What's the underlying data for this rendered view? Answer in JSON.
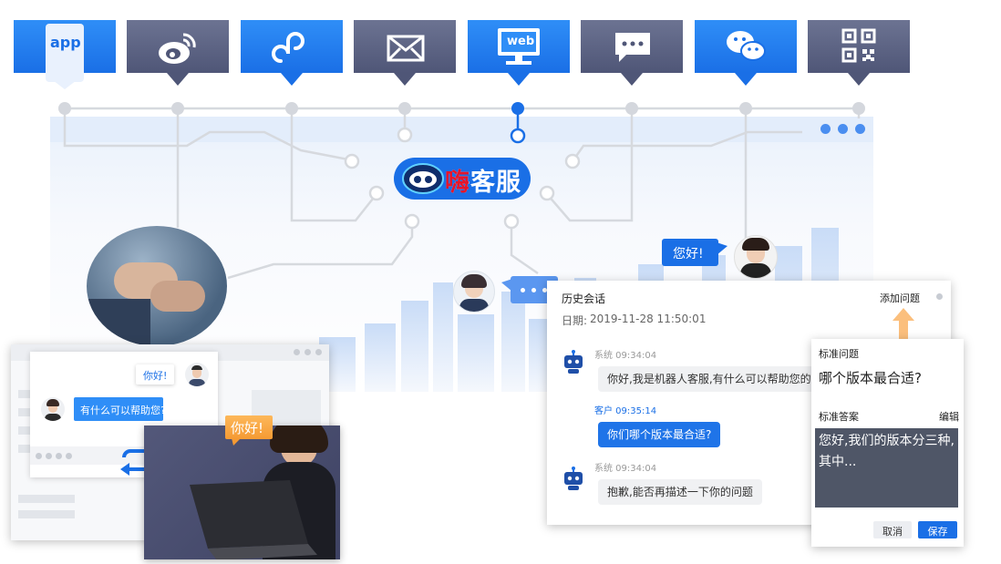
{
  "channels": [
    {
      "key": "app",
      "label": "app",
      "icon": "app-icon",
      "style": "blue"
    },
    {
      "key": "weibo",
      "label": "",
      "icon": "weibo-icon",
      "style": "gray"
    },
    {
      "key": "miniprogram",
      "label": "",
      "icon": "miniprogram-icon",
      "style": "blue"
    },
    {
      "key": "email",
      "label": "",
      "icon": "mail-icon",
      "style": "gray"
    },
    {
      "key": "web",
      "label": "web",
      "icon": "monitor-icon",
      "style": "blue"
    },
    {
      "key": "sms",
      "label": "",
      "icon": "message-icon",
      "style": "gray"
    },
    {
      "key": "wechat",
      "label": "",
      "icon": "wechat-icon",
      "style": "blue"
    },
    {
      "key": "qrcode",
      "label": "",
      "icon": "qrcode-icon",
      "style": "gray"
    }
  ],
  "brand": {
    "name": "嗨客服",
    "logo_icon": "robot-face-icon",
    "accent": "#1a6fe6",
    "red": "#e3162c"
  },
  "greetings": {
    "right_bubble": "您好!",
    "video_bubble": "你好!",
    "typing_bubble": "..."
  },
  "mini_chat": {
    "agent_bubble": "你好!",
    "customer_bubble": "有什么可以帮助您?"
  },
  "history": {
    "title": "历史会话",
    "add_question": "添加问题",
    "date_label": "日期:",
    "date_value": "2019-11-28  11:50:01",
    "messages": [
      {
        "sender": "系统 09:34:04",
        "text": "你好,我是机器人客服,有什么可以帮助您的?",
        "side": "left"
      },
      {
        "sender": "客户 09:35:14",
        "text": "你们哪个版本最合适?",
        "side": "right"
      },
      {
        "sender": "系统 09:34:04",
        "text": "抱歉,能否再描述一下你的问题",
        "side": "left"
      }
    ]
  },
  "standard": {
    "question_title": "标准问题",
    "question_text": "哪个版本最合适?",
    "answer_title": "标准答案",
    "edit_label": "编辑",
    "answer_text": "您好,我们的版本分三种,其中...",
    "cancel_label": "取消",
    "save_label": "保存"
  }
}
